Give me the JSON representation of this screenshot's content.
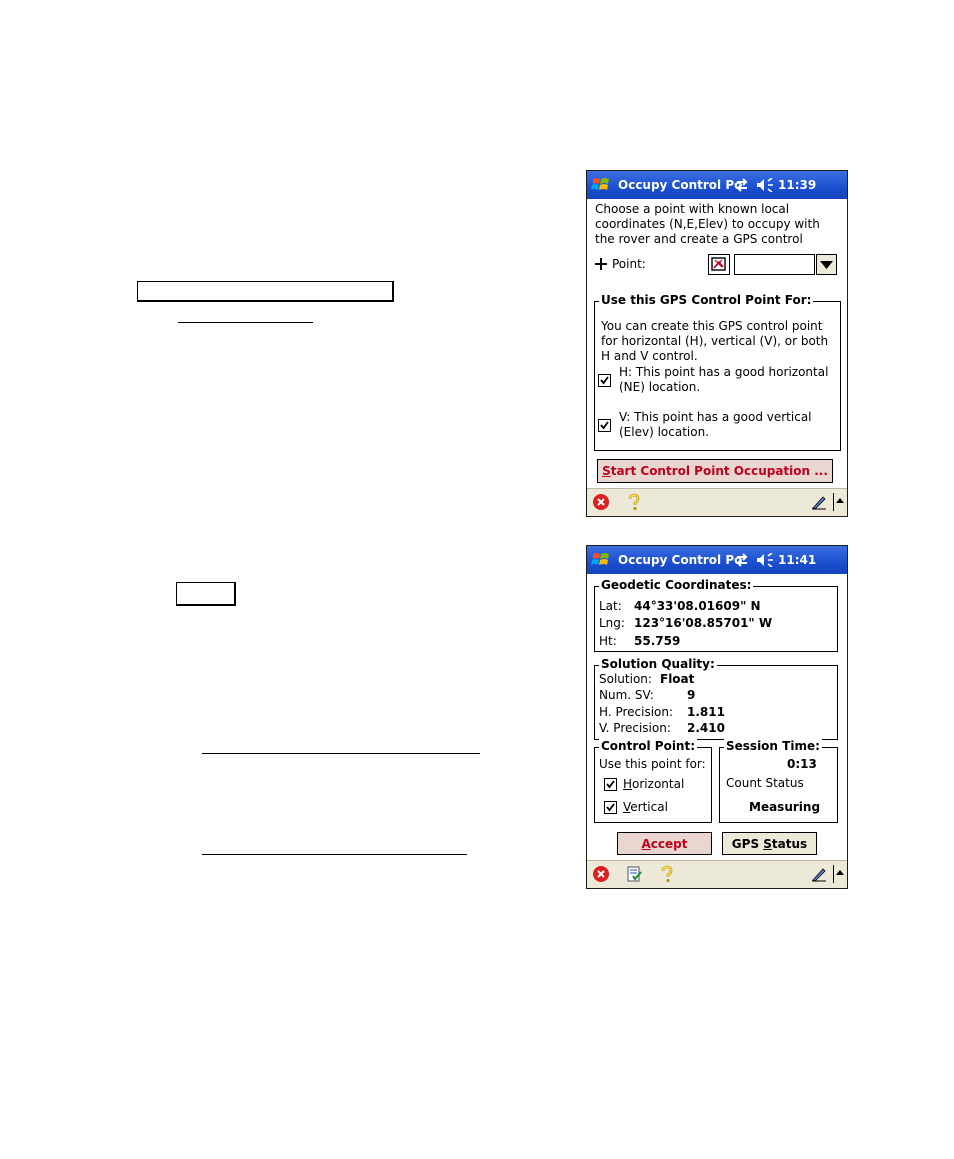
{
  "screen1": {
    "title": "Occupy Control Po",
    "time": "11:39",
    "instructions": [
      "Choose a point with known local",
      "coordinates (N,E,Elev) to occupy with",
      "the rover and create a GPS control"
    ],
    "point_label": "Point:",
    "point_value": "",
    "group_title": "Use this GPS Control Point For:",
    "group_text": [
      "You can create this GPS control point",
      "for horizontal (H), vertical (V), or both",
      "H and V control."
    ],
    "h_option": [
      "H:  This point has a good horizontal",
      "(NE) location."
    ],
    "h_checked": true,
    "v_option": [
      "V:  This point has a good vertical",
      "(Elev) location."
    ],
    "v_checked": true,
    "start_button": {
      "key": "S",
      "rest": "tart Control Point Occupation ..."
    }
  },
  "screen2": {
    "title": "Occupy Control Po",
    "time": "11:41",
    "geodetic": {
      "title": "Geodetic Coordinates:",
      "lat_label": "Lat:",
      "lat_value": "44°33'08.01609\" N",
      "lng_label": "Lng:",
      "lng_value": "123°16'08.85701\" W",
      "ht_label": "Ht:",
      "ht_value": "55.759"
    },
    "quality": {
      "title": "Solution Quality:",
      "solution_label": "Solution:",
      "solution_value": "Float",
      "numsv_label": "Num. SV:",
      "numsv_value": "9",
      "hprec_label": "H. Precision:",
      "hprec_value": "1.811",
      "vprec_label": "V. Precision:",
      "vprec_value": "2.410"
    },
    "control_point": {
      "title": "Control Point:",
      "use_label": "Use this point for:",
      "horizontal": {
        "key": "H",
        "rest": "orizontal"
      },
      "horizontal_checked": true,
      "vertical": {
        "key": "V",
        "rest": "ertical"
      },
      "vertical_checked": true
    },
    "session": {
      "title": "Session Time:",
      "time": "0:13",
      "count_status": "Count Status",
      "status": "Measuring"
    },
    "accept_button": {
      "key": "A",
      "rest": "ccept"
    },
    "gps_status_button": {
      "before": "GPS ",
      "key": "S",
      "rest": "tatus"
    }
  },
  "icons": [
    "windows-start-icon",
    "connectivity-icon",
    "speaker-icon",
    "close-error-icon",
    "help-icon",
    "task-list-icon",
    "pen-input-icon",
    "sip-arrow-icon",
    "checkmark-icon",
    "point-picker-icon",
    "dropdown-arrow-icon",
    "plus-icon"
  ],
  "colors": {
    "titlebar": "#1a4fd0",
    "toolbar": "#ece9d8",
    "accent_text": "#c0001c",
    "error_icon": "#d92020"
  }
}
